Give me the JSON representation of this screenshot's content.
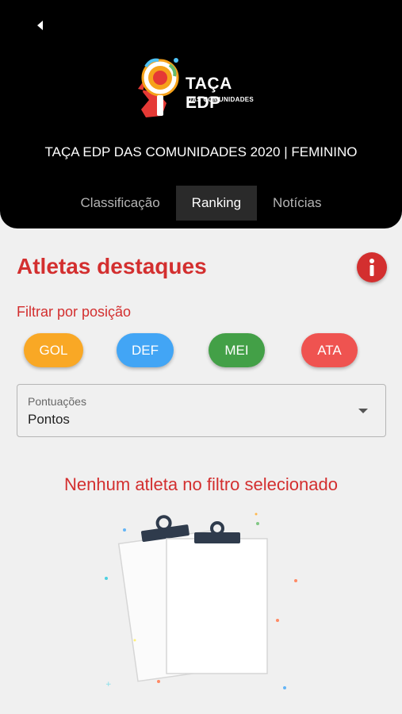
{
  "header": {
    "back_icon": "back-arrow-icon",
    "logo": {
      "line1": "TAÇA EDP",
      "line2": "DAS COMUNIDADES"
    },
    "title": "TAÇA EDP DAS COMUNIDADES 2020 | FEMININO",
    "tabs": [
      {
        "label": "Classificação",
        "active": false
      },
      {
        "label": "Ranking",
        "active": true
      },
      {
        "label": "Notícias",
        "active": false
      }
    ]
  },
  "main": {
    "title": "Atletas destaques",
    "info_icon": "info-icon",
    "filter_label": "Filtrar por posição",
    "positions": [
      {
        "label": "GOL",
        "color": "#f9a825"
      },
      {
        "label": "DEF",
        "color": "#42a5f5"
      },
      {
        "label": "MEI",
        "color": "#43a047"
      },
      {
        "label": "ATA",
        "color": "#ef5350"
      }
    ],
    "select": {
      "label": "Pontuações",
      "value": "Pontos"
    },
    "empty_message": "Nenhum atleta no filtro selecionado"
  },
  "colors": {
    "accent": "#d32f2f",
    "header_bg": "#000000",
    "page_bg": "#f0f0f0"
  }
}
